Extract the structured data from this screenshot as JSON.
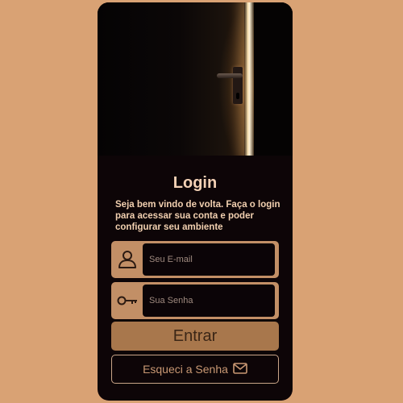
{
  "login": {
    "title": "Login",
    "subtitle": "Seja bem vindo de volta. Faça o login para acessar sua conta e poder configurar seu ambiente",
    "email_placeholder": "Seu E-mail",
    "password_placeholder": "Sua Senha",
    "submit_label": "Entrar",
    "forgot_label": "Esqueci a Senha"
  },
  "icons": {
    "email_field": "user-icon",
    "password_field": "key-icon",
    "forgot": "mail-icon"
  },
  "colors": {
    "background": "#d9a274",
    "card": "#0d0507",
    "accent": "#c28f66",
    "button": "#a8774c",
    "title_text": "#f3d1b5"
  }
}
